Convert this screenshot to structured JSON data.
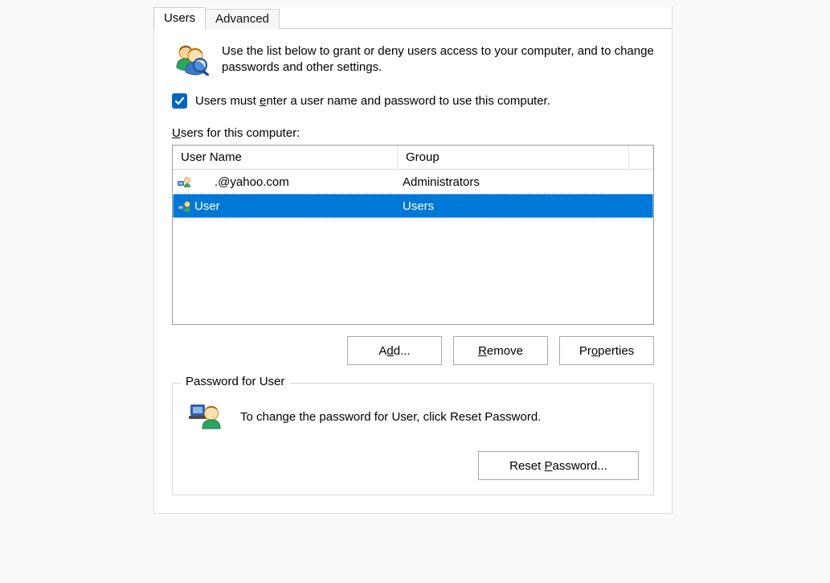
{
  "tabs": {
    "users": "Users",
    "advanced": "Advanced"
  },
  "intro": "Use the list below to grant or deny users access to your computer, and to change passwords and other settings.",
  "checkbox_label_pre": "Users must ",
  "checkbox_label_hot": "e",
  "checkbox_label_post": "nter a user name and password to use this computer.",
  "checkbox_checked": true,
  "list_label_hot": "U",
  "list_label_rest": "sers for this computer:",
  "columns": {
    "name": "User Name",
    "group": "Group"
  },
  "rows": [
    {
      "name": "      .@yahoo.com",
      "group": "Administrators",
      "selected": false
    },
    {
      "name": "User",
      "group": "Users",
      "selected": true
    }
  ],
  "buttons": {
    "add_pre": "A",
    "add_hot": "d",
    "add_post": "d...",
    "remove_hot": "R",
    "remove_post": "emove",
    "properties_pre": "Pr",
    "properties_hot": "o",
    "properties_post": "perties",
    "reset_pre": "Reset ",
    "reset_hot": "P",
    "reset_post": "assword..."
  },
  "groupbox": {
    "legend": "Password for User",
    "text": "To change the password for User, click Reset Password."
  }
}
